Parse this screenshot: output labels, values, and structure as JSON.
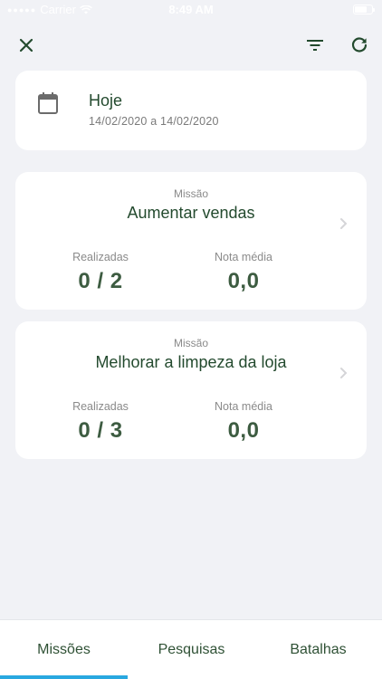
{
  "status_bar": {
    "carrier": "Carrier",
    "time": "8:49 AM"
  },
  "toolbar": {
    "close_icon": "close-icon",
    "filter_icon": "filter-icon",
    "refresh_icon": "refresh-icon"
  },
  "date_filter": {
    "icon": "calendar-icon",
    "title": "Hoje",
    "range": "14/02/2020 a 14/02/2020"
  },
  "missions": [
    {
      "label": "Missão",
      "name": "Aumentar vendas",
      "done_label": "Realizadas",
      "done_value": "0 / 2",
      "score_label": "Nota média",
      "score_value": "0,0"
    },
    {
      "label": "Missão",
      "name": "Melhorar a limpeza da loja",
      "done_label": "Realizadas",
      "done_value": "0 / 3",
      "score_label": "Nota média",
      "score_value": "0,0"
    }
  ],
  "tabs": [
    {
      "label": "Missões",
      "active": true
    },
    {
      "label": "Pesquisas",
      "active": false
    },
    {
      "label": "Batalhas",
      "active": false
    }
  ],
  "colors": {
    "background": "#f1f2f6",
    "primary_text": "#234a2e",
    "accent_indicator": "#29a8e0"
  }
}
